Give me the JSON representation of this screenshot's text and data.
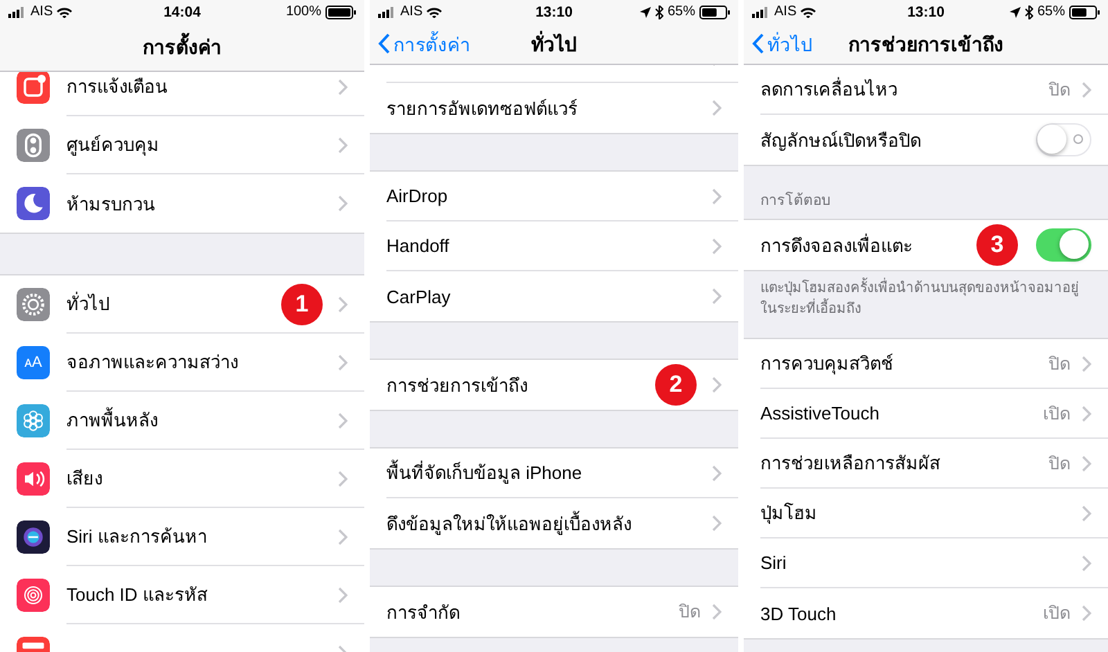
{
  "panels": [
    {
      "status_bar": {
        "carrier": "AIS",
        "time": "14:04",
        "battery": "100%",
        "location": false,
        "bluetooth": false
      },
      "nav": {
        "title": "การตั้งค่า"
      },
      "sections": [
        {
          "rows": [
            {
              "kind": "link",
              "label": "การแจ้งเตือน",
              "color": "#fc3d39"
            },
            {
              "kind": "link",
              "label": "ศูนย์ควบคุม",
              "color": "#8e8e93"
            },
            {
              "kind": "link",
              "label": "ห้ามรบกวน",
              "color": "#5856d6"
            }
          ]
        },
        {
          "rows": [
            {
              "kind": "link",
              "label": "ทั่วไป",
              "color": "#8e8e93",
              "badge": "1"
            },
            {
              "kind": "link",
              "label": "จอภาพและความสว่าง",
              "color": "#147efb",
              "glyph": "ᴀA"
            },
            {
              "kind": "link",
              "label": "ภาพพื้นหลัง",
              "color": "#35aadc"
            },
            {
              "kind": "link",
              "label": "เสียง",
              "color": "#fc3158"
            },
            {
              "kind": "link",
              "label": "Siri และการค้นหา",
              "color": "#1c1b3a"
            },
            {
              "kind": "link",
              "label": "Touch ID และรหัส",
              "color": "#fc3158"
            },
            {
              "kind": "link",
              "color": "#fc3d39"
            }
          ]
        }
      ]
    },
    {
      "status_bar": {
        "carrier": "AIS",
        "time": "13:10",
        "battery": "65%",
        "location": true,
        "bluetooth": true
      },
      "nav": {
        "back": "การตั้งค่า",
        "title": "ทั่วไป"
      },
      "sections": [
        {
          "rows": [
            {
              "kind": "link"
            },
            {
              "kind": "link",
              "label": "รายการอัพเดทซอฟต์แวร์"
            }
          ]
        },
        {
          "rows": [
            {
              "kind": "link",
              "label": "AirDrop"
            },
            {
              "kind": "link",
              "label": "Handoff"
            },
            {
              "kind": "link",
              "label": "CarPlay"
            }
          ]
        },
        {
          "rows": [
            {
              "kind": "link",
              "label": "การช่วยการเข้าถึง",
              "badge": "2"
            }
          ]
        },
        {
          "rows": [
            {
              "kind": "link",
              "label": "พื้นที่จัดเก็บข้อมูล iPhone"
            },
            {
              "kind": "link",
              "label": "ดึงข้อมูลใหม่ให้แอพอยู่เบื้องหลัง"
            }
          ]
        },
        {
          "rows": [
            {
              "kind": "link",
              "label": "การจำกัด",
              "value": "ปิด"
            }
          ]
        }
      ]
    },
    {
      "status_bar": {
        "carrier": "AIS",
        "time": "13:10",
        "battery": "65%",
        "location": true,
        "bluetooth": true
      },
      "nav": {
        "back": "ทั่วไป",
        "title": "การช่วยการเข้าถึง"
      },
      "sections": [
        {
          "rows": [
            {
              "kind": "link",
              "label": "ลดการเคลื่อนไหว",
              "value": "ปิด"
            },
            {
              "kind": "toggle",
              "label": "สัญลักษณ์เปิดหรือปิด",
              "on": false
            }
          ]
        },
        {
          "header": "การโต้ตอบ",
          "rows": [
            {
              "kind": "toggle",
              "label": "การดึงจอลงเพื่อแตะ",
              "on": true,
              "badge": "3"
            }
          ],
          "footer": "แตะปุ่มโฮมสองครั้งเพื่อนำด้านบนสุดของหน้าจอมาอยู่ในระยะที่เอื้อมถึง"
        },
        {
          "rows": [
            {
              "kind": "link",
              "label": "การควบคุมสวิตช์",
              "value": "ปิด"
            },
            {
              "kind": "link",
              "label": "AssistiveTouch",
              "value": "เปิด"
            },
            {
              "kind": "link",
              "label": "การช่วยเหลือการสัมผัส",
              "value": "ปิด"
            },
            {
              "kind": "link",
              "label": "ปุ่มโฮม"
            },
            {
              "kind": "link",
              "label": "Siri"
            },
            {
              "kind": "link",
              "label": "3D Touch",
              "value": "เปิด"
            }
          ]
        }
      ]
    }
  ]
}
